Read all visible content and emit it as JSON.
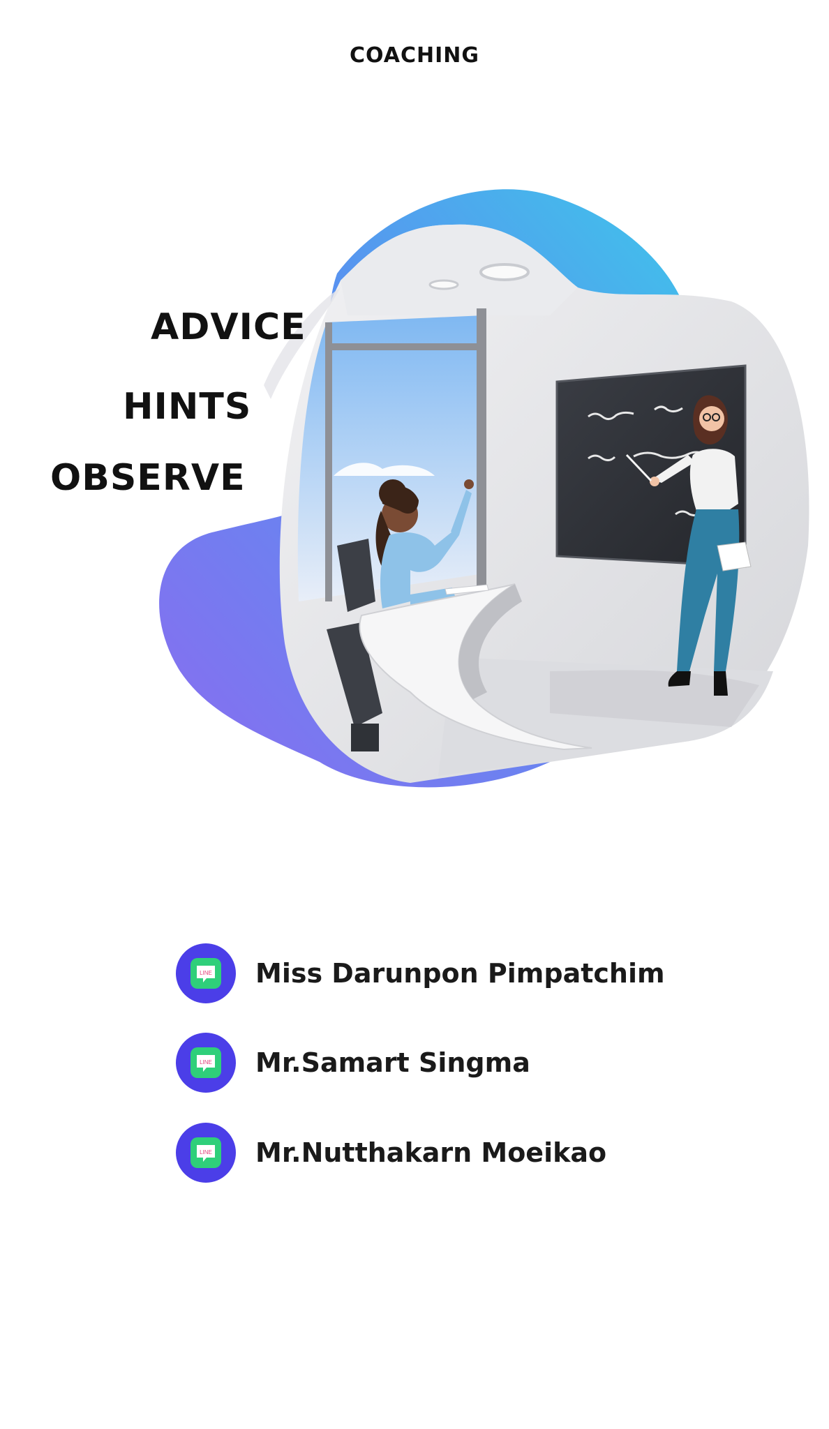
{
  "header": {
    "title": "COACHING"
  },
  "keywords": [
    "ADVICE",
    "HINTS",
    "OBSERVE"
  ],
  "contacts": [
    {
      "name": "Miss Darunpon Pimpatchim",
      "icon": "line-app-icon",
      "icon_text": "LINE"
    },
    {
      "name": "Mr.Samart Singma",
      "icon": "line-app-icon",
      "icon_text": "LINE"
    },
    {
      "name": "Mr.Nutthakarn Moeikao",
      "icon": "line-app-icon",
      "icon_text": "LINE"
    }
  ],
  "colors": {
    "icon_circle": "#4b3ee8",
    "line_green": "#2fcf7a",
    "blob_gradient_start": "#8a6cf0",
    "blob_gradient_end": "#3ec6ea"
  }
}
